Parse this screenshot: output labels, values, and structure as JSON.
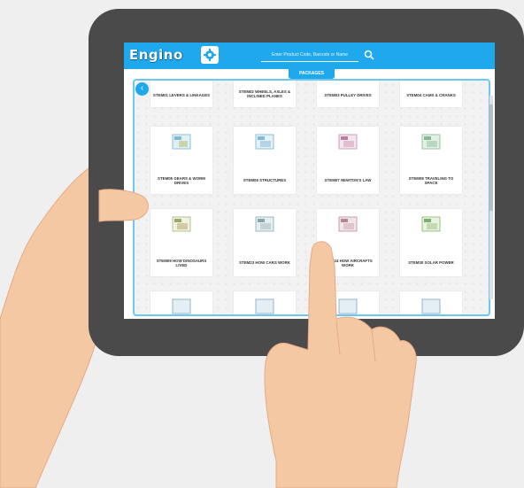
{
  "app": {
    "logo": "Engino"
  },
  "search": {
    "placeholder": "Enter Product Code, Barcode or Name"
  },
  "section": {
    "title": "PACKAGES"
  },
  "packages": [
    "STEM01 LEVERS & LINKAGES",
    "STEM02 WHEELS, AXLES & INCLINED PLANES",
    "STEM03 PULLEY DRIVES",
    "STEM04 CAMS & CRANKS",
    "STEM05 GEARS & WORM DRIVES",
    "STEM06 STRUCTURES",
    "STEM07 NEWTON'S LAW",
    "STEM08 TRAVELING TO SPACE",
    "STEM09 HOW DINOSAURS LIVED",
    "STEM23 HOW CARS WORK",
    "STEM24 HOW AIRCRAFTS WORK",
    "STEM30 SOLAR POWER"
  ],
  "colors": {
    "accent": "#1fa9ec",
    "tablet": "#4a4a4a",
    "skin": "#f5c8a4"
  }
}
